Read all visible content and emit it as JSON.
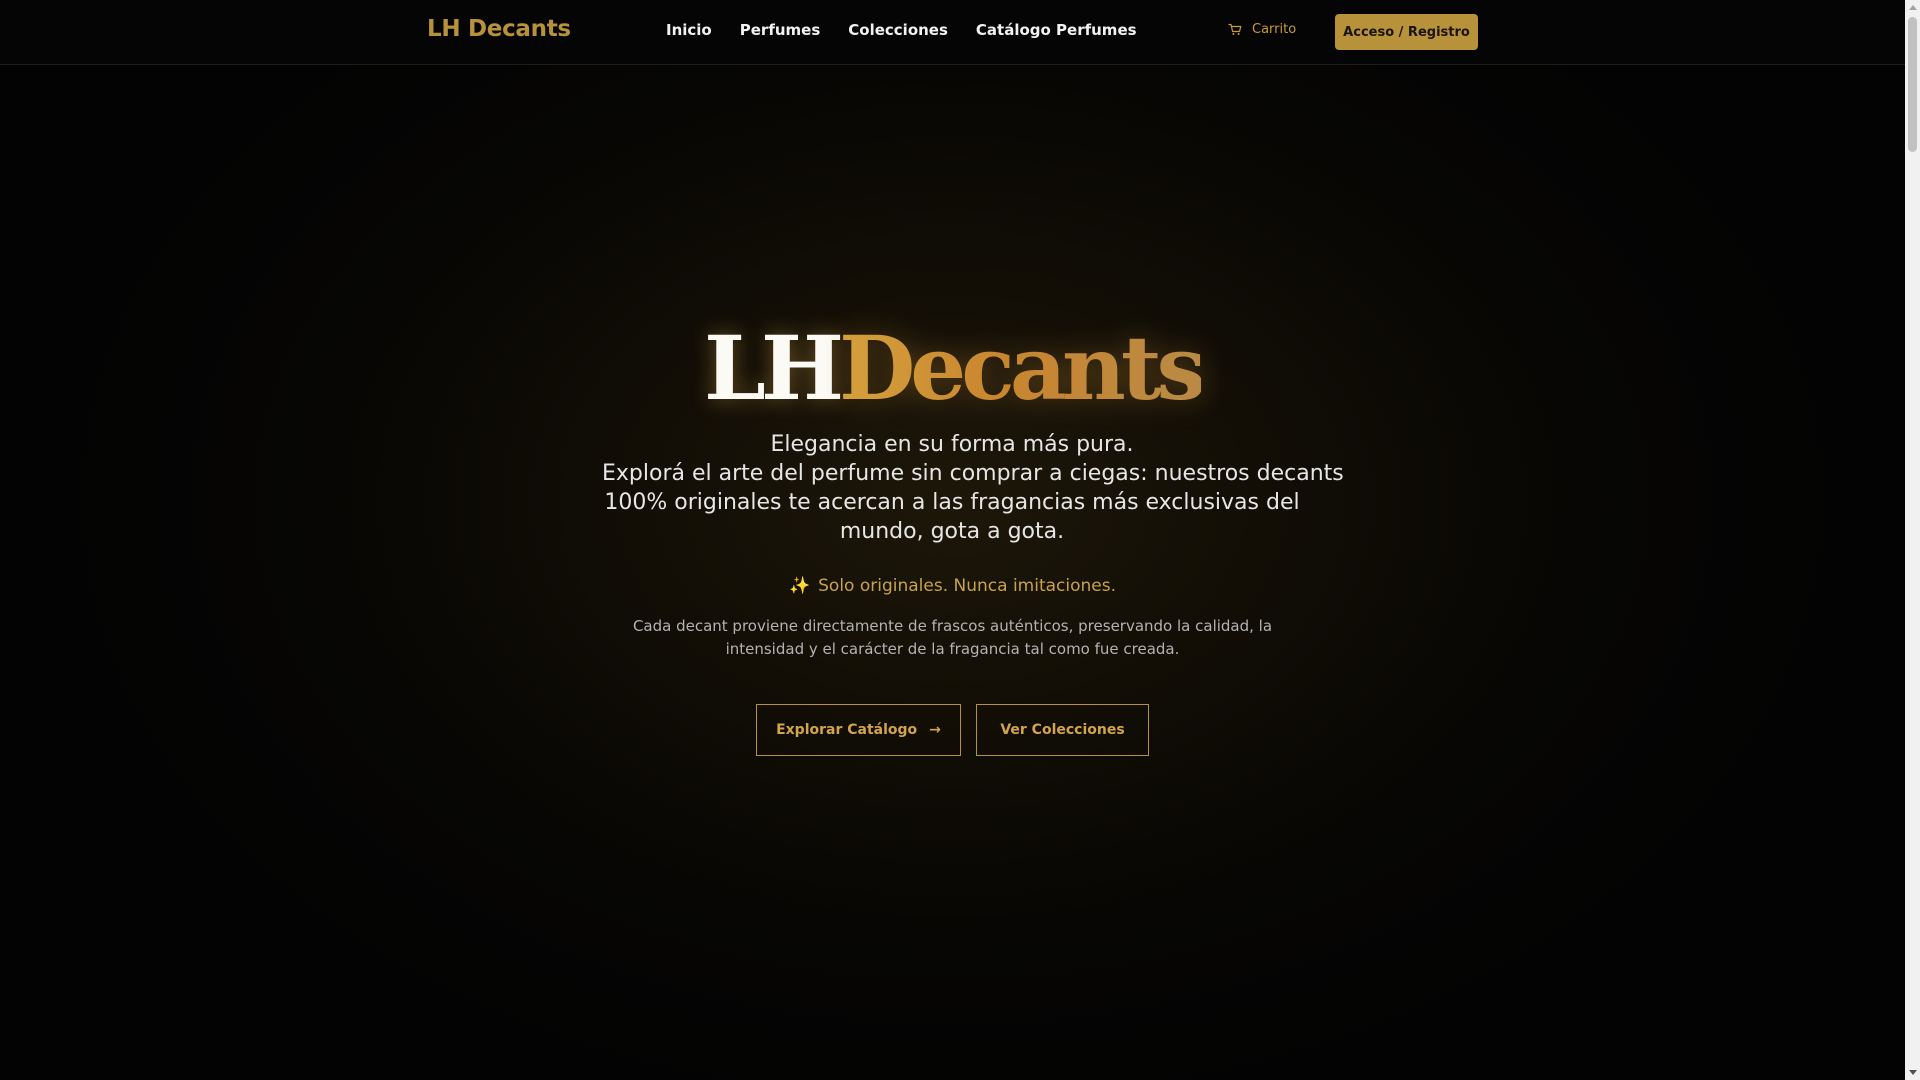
{
  "nav": {
    "brand": "LH Decants",
    "links": [
      "Inicio",
      "Perfumes",
      "Colecciones",
      "Catálogo Perfumes"
    ],
    "cart_label": "Carrito",
    "login_label": "Acceso / Registro"
  },
  "hero": {
    "title_part1": "LH",
    "title_part2": "Decants",
    "lead": [
      "Elegancia en su forma más pura.",
      "Explorá el arte del perfume sin comprar a ciegas: nuestros decants",
      "100% originales te acercan a las fragancias más exclusivas del",
      "mundo, gota a gota."
    ],
    "tagline_icon": "sparkles-icon",
    "tagline": "Solo originales. Nunca imitaciones.",
    "description": [
      "Cada decant proviene directamente de frascos auténticos, preservando la calidad, la",
      "intensidad y el carácter de la fragancia tal como fue creada."
    ],
    "primary_button": "Explorar Catálogo",
    "primary_button_icon": "arrow-right-icon",
    "secondary_button": "Ver Colecciones"
  },
  "colors": {
    "accent": "#b8913b",
    "background": "#050505",
    "text": "#f2f2f2"
  }
}
